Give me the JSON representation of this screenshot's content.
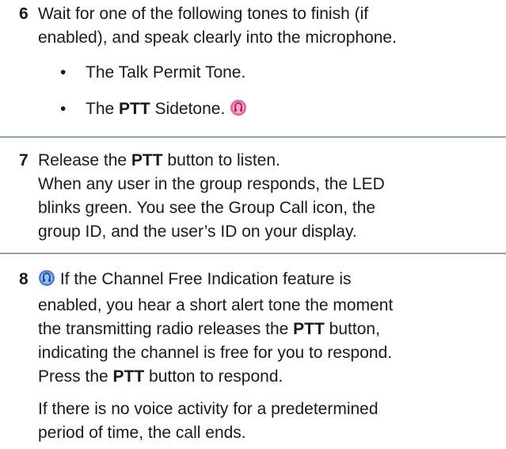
{
  "step6": {
    "number": "6",
    "lines": [
      "Wait for one of the following tones to finish (if",
      "enabled), and speak clearly into the microphone."
    ],
    "bullets": [
      {
        "bullet": "•",
        "pre": "The Talk Permit Tone.",
        "bold": "",
        "post": ""
      },
      {
        "bullet": "•",
        "pre": "The ",
        "bold": "PTT",
        "post": " Sidetone."
      }
    ],
    "icon": "pink-speaker-icon"
  },
  "step7": {
    "number": "7",
    "line1_pre": "Release the ",
    "line1_bold": "PTT",
    "line1_post": " button to listen.",
    "lines": [
      "When any user in the group responds, the LED",
      "blinks green. You see the Group Call icon, the",
      "group ID, and the user’s ID on your display."
    ]
  },
  "step8": {
    "number": "8",
    "icon": "blue-speaker-icon",
    "line1": " If the Channel Free Indication feature is",
    "line2": "enabled, you hear a short alert tone the moment",
    "line3_pre": "the transmitting radio releases the ",
    "line3_bold": "PTT",
    "line3_post": " button,",
    "line4": "indicating the channel is free for you to respond.",
    "line5_pre": "Press the ",
    "line5_bold": "PTT",
    "line5_post": " button to respond.",
    "para2": [
      "If there is no voice activity for a predetermined",
      "period of time, the call ends."
    ]
  }
}
